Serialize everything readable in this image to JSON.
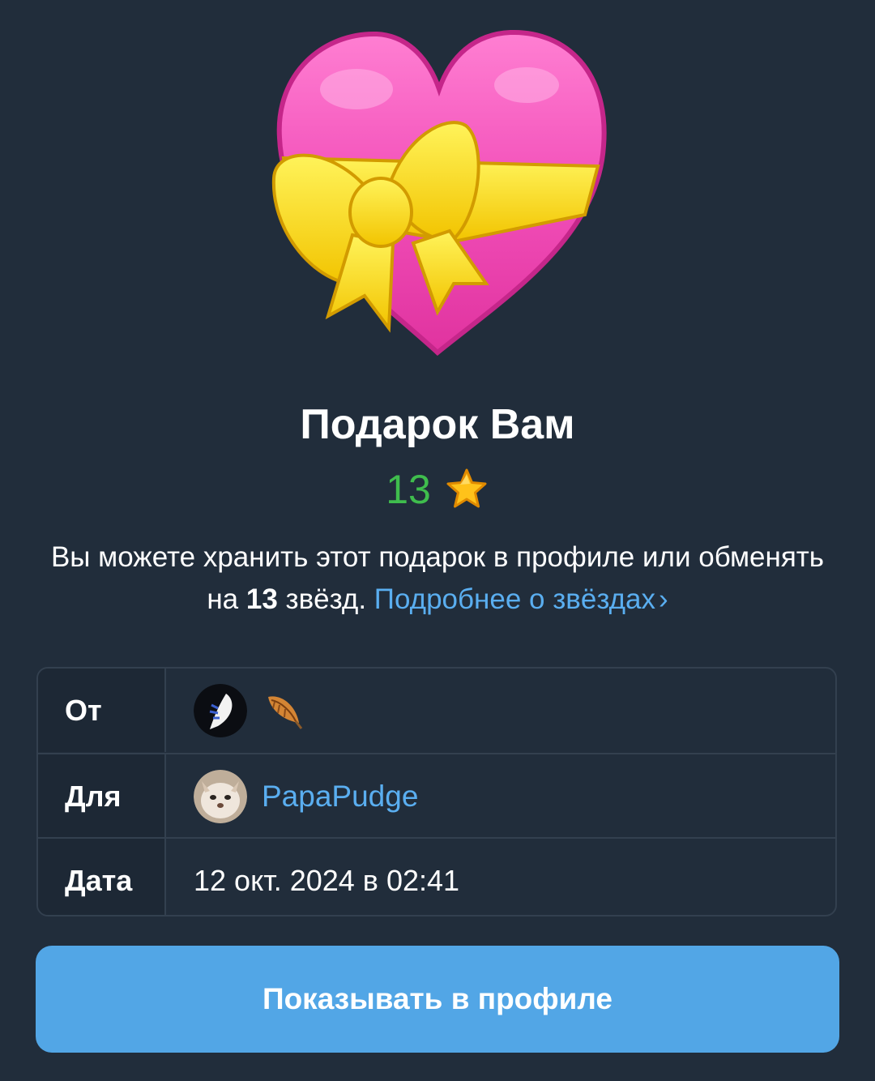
{
  "gift": {
    "title": "Подарок Вам",
    "price": "13",
    "price_icon": "star-icon"
  },
  "description": {
    "text_before": "Вы можете хранить этот подарок в профиле или обменять на ",
    "bold_amount": "13",
    "text_after": " звёзд. ",
    "link_label": "Подробнее о звёздах",
    "link_chevron": "›"
  },
  "details": {
    "from_label": "От",
    "from_icon": "feather-icon",
    "to_label": "Для",
    "to_username": "PapaPudge",
    "date_label": "Дата",
    "date_value": "12 окт. 2024 в 02:41"
  },
  "actions": {
    "show_in_profile_label": "Показывать в профиле"
  },
  "colors": {
    "background": "#212d3b",
    "price_green": "#3fbd4d",
    "link_blue": "#5aaef0",
    "button_blue": "#52a6e6"
  }
}
